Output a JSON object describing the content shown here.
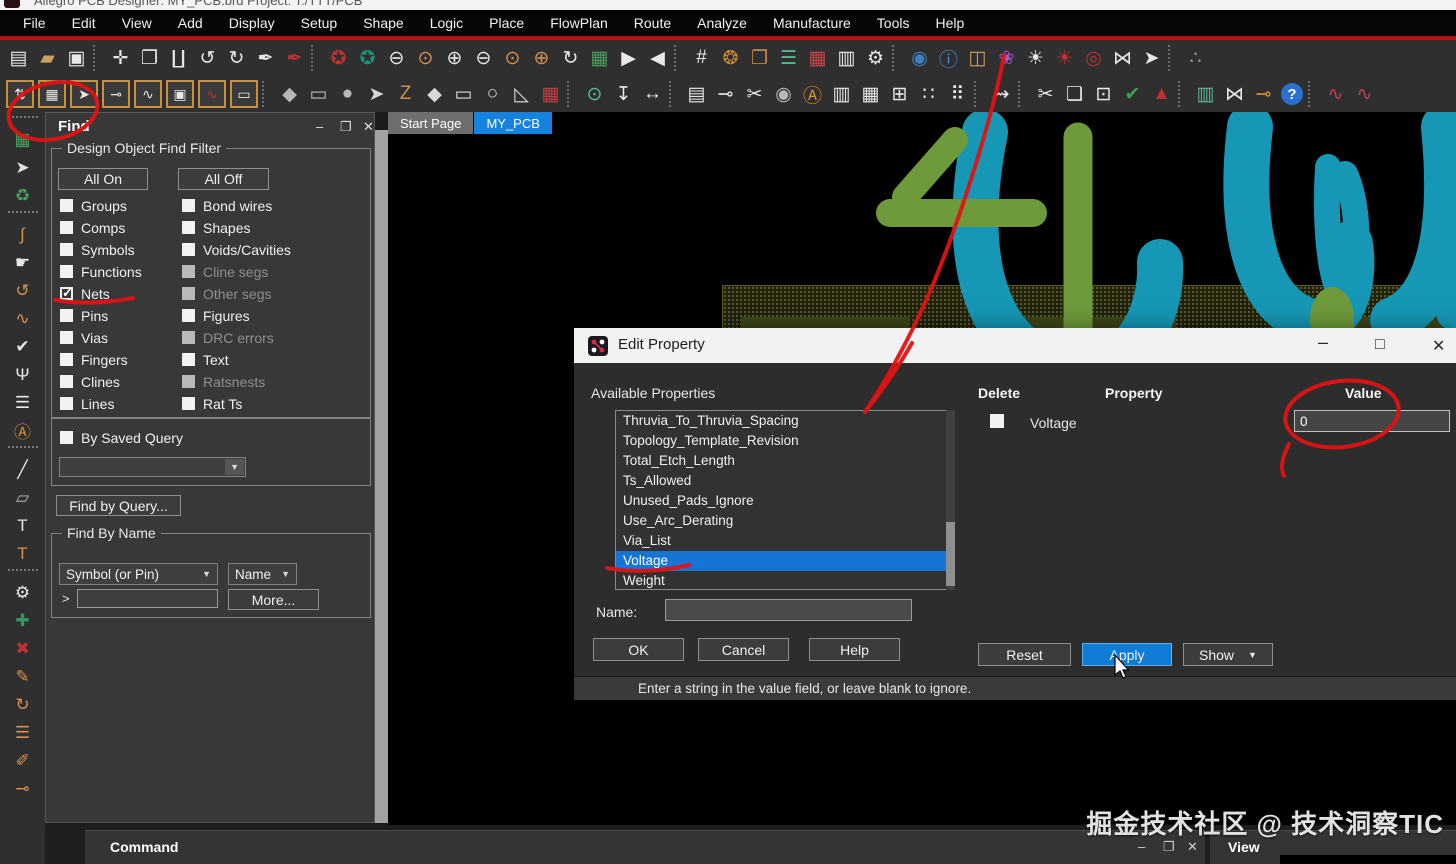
{
  "window": {
    "title": "Allegro PCB Designer: MY_PCB.brd Project: T:/TTT/PCB"
  },
  "menu": {
    "items": [
      "File",
      "Edit",
      "View",
      "Add",
      "Display",
      "Setup",
      "Shape",
      "Logic",
      "Place",
      "FlowPlan",
      "Route",
      "Analyze",
      "Manufacture",
      "Tools",
      "Help"
    ]
  },
  "toolbar1": {
    "icons": [
      {
        "name": "new-drawing",
        "glyph": "▤",
        "color": "#e8e8e8"
      },
      {
        "name": "open-drawing",
        "glyph": "▰",
        "color": "#c9a25e"
      },
      {
        "name": "save-drawing",
        "glyph": "▣",
        "color": "#e8e8e8"
      },
      {
        "name": "separator",
        "type": "sep"
      },
      {
        "name": "move",
        "glyph": "✛",
        "color": "#e8e8e8"
      },
      {
        "name": "copy",
        "glyph": "❐",
        "color": "#e8e8e8"
      },
      {
        "name": "delete",
        "glyph": "∐",
        "color": "#e8e8e8"
      },
      {
        "name": "undo",
        "glyph": "↺",
        "color": "#e8e8e8"
      },
      {
        "name": "redo",
        "glyph": "↻",
        "color": "#e8e8e8"
      },
      {
        "name": "pin",
        "glyph": "✒",
        "color": "#e8e8e8"
      },
      {
        "name": "unpin",
        "glyph": "✒",
        "color": "#c03030"
      },
      {
        "name": "separator",
        "type": "sep"
      },
      {
        "name": "highlight-red-circle",
        "glyph": "✪",
        "color": "#c03030"
      },
      {
        "name": "highlight-green-circle",
        "glyph": "✪",
        "color": "#1f8f7a"
      },
      {
        "name": "zoom-out-small",
        "glyph": "⊖",
        "color": "#e8e8e8"
      },
      {
        "name": "zoom-region",
        "glyph": "⊙",
        "color": "#d89050"
      },
      {
        "name": "zoom-in",
        "glyph": "⊕",
        "color": "#e8e8e8"
      },
      {
        "name": "zoom-out",
        "glyph": "⊖",
        "color": "#e8e8e8"
      },
      {
        "name": "zoom-previous",
        "glyph": "⊙",
        "color": "#d89050"
      },
      {
        "name": "zoom-center",
        "glyph": "⊕",
        "color": "#d89050"
      },
      {
        "name": "redraw",
        "glyph": "↻",
        "color": "#e8e8e8"
      },
      {
        "name": "board-view",
        "glyph": "▦",
        "color": "#49a35c"
      },
      {
        "name": "flip-forward",
        "glyph": "▶",
        "color": "#e8e8e8"
      },
      {
        "name": "flip-back",
        "glyph": "◀",
        "color": "#e8e8e8"
      },
      {
        "name": "separator",
        "type": "sep"
      },
      {
        "name": "grid-toggle",
        "glyph": "#",
        "color": "#e8e8e8"
      },
      {
        "name": "color-wheel",
        "glyph": "❂",
        "color": "#d08a2e"
      },
      {
        "name": "color-copy",
        "glyph": "❐",
        "color": "#c98f4a"
      },
      {
        "name": "layer-stack",
        "glyph": "☰",
        "color": "#58b890"
      },
      {
        "name": "color-dialog-doc",
        "glyph": "▦",
        "color": "#cc4444"
      },
      {
        "name": "report-doc",
        "glyph": "▥",
        "color": "#e8e8e8"
      },
      {
        "name": "parameter-doc",
        "glyph": "⚙",
        "color": "#e8e8e8"
      },
      {
        "name": "separator",
        "type": "sep"
      },
      {
        "name": "visibility-eye",
        "glyph": "◉",
        "color": "#3d7fc4"
      },
      {
        "name": "element-info",
        "glyph": "ⓘ",
        "color": "#4a8fd4"
      },
      {
        "name": "measure-3d",
        "glyph": "◫",
        "color": "#c9a25e"
      },
      {
        "name": "color-palette",
        "glyph": "❀",
        "color": "#9a5ac8"
      },
      {
        "name": "shine-on",
        "glyph": "☀",
        "color": "#e8e8e8"
      },
      {
        "name": "shine-off",
        "glyph": "☀",
        "color": "#c03030"
      },
      {
        "name": "filled-pads-off",
        "glyph": "◎",
        "color": "#c03030"
      },
      {
        "name": "waitstate-hourglass",
        "glyph": "⋈",
        "color": "#e8e8e8"
      },
      {
        "name": "pick-cursor",
        "glyph": "➤",
        "color": "#e8e8e8"
      },
      {
        "name": "separator",
        "type": "sep"
      },
      {
        "name": "share",
        "glyph": "∴",
        "color": "#9a9a9a"
      }
    ]
  },
  "toolbar2": {
    "icons": [
      {
        "name": "show-measure",
        "glyph": "⇅",
        "color": "#e8e8e8",
        "type": "framed"
      },
      {
        "name": "highlight-element",
        "glyph": "▦",
        "color": "#e8e8e8",
        "type": "framed"
      },
      {
        "name": "select-element",
        "glyph": "➤",
        "color": "#e8e8e8",
        "type": "framed"
      },
      {
        "name": "probe-pin",
        "glyph": "⊸",
        "color": "#e8e8e8",
        "type": "framed"
      },
      {
        "name": "waveform-probe",
        "glyph": "∿",
        "color": "#e8e8e8",
        "type": "framed"
      },
      {
        "name": "drc-browser",
        "glyph": "▣",
        "color": "#e8e8e8",
        "type": "framed"
      },
      {
        "name": "elongation-curve",
        "glyph": "∿",
        "color": "#c03030",
        "type": "framed"
      },
      {
        "name": "frame-select",
        "glyph": "▭",
        "color": "#e8e8e8",
        "type": "framed"
      },
      {
        "name": "separator",
        "type": "sep"
      },
      {
        "name": "add-polygon",
        "glyph": "◆",
        "color": "#b8b8b8"
      },
      {
        "name": "add-rectangle",
        "glyph": "▭",
        "color": "#b8b8b8"
      },
      {
        "name": "add-circle",
        "glyph": "●",
        "color": "#b8b8b8"
      },
      {
        "name": "select-shape",
        "glyph": "➤",
        "color": "#d8d8d8"
      },
      {
        "name": "edit-boundary",
        "glyph": "Z",
        "color": "#c98f4a"
      },
      {
        "name": "shape-polygon",
        "glyph": "◆",
        "color": "#d8d8d8"
      },
      {
        "name": "shape-rectangle",
        "glyph": "▭",
        "color": "#d8d8d8"
      },
      {
        "name": "shape-circle",
        "glyph": "○",
        "color": "#d8d8d8"
      },
      {
        "name": "shape-wedge",
        "glyph": "◺",
        "color": "#d8d8d8"
      },
      {
        "name": "shape-board",
        "glyph": "▦",
        "color": "#c04040"
      },
      {
        "name": "separator",
        "type": "sep"
      },
      {
        "name": "zoom-highlight",
        "glyph": "⊙",
        "color": "#52c09a"
      },
      {
        "name": "dimension-drop",
        "glyph": "↧",
        "color": "#e8e8e8"
      },
      {
        "name": "spacing-arrows",
        "glyph": "↔",
        "color": "#e8e8e8"
      },
      {
        "name": "separator",
        "type": "sep"
      },
      {
        "name": "export-doc",
        "glyph": "▤",
        "color": "#e8e8e8"
      },
      {
        "name": "pin-report",
        "glyph": "⊸",
        "color": "#e8e8e8"
      },
      {
        "name": "pin-tools",
        "glyph": "✂",
        "color": "#e8e8e8"
      },
      {
        "name": "camera-settings",
        "glyph": "◉",
        "color": "#b8b8b8"
      },
      {
        "name": "auto-rename-r2",
        "glyph": "Ⓐ",
        "color": "#d89030"
      },
      {
        "name": "pin-doc",
        "glyph": "▥",
        "color": "#e8e8e8"
      },
      {
        "name": "grid-window",
        "glyph": "▦",
        "color": "#e8e8e8"
      },
      {
        "name": "testpoint-grid",
        "glyph": "⊞",
        "color": "#e8e8e8"
      },
      {
        "name": "dots-pattern",
        "glyph": "∷",
        "color": "#e8e8e8"
      },
      {
        "name": "pads-pattern",
        "glyph": "⠿",
        "color": "#e8e8e8"
      },
      {
        "name": "separator",
        "type": "sep"
      },
      {
        "name": "route-segment",
        "glyph": "⇝",
        "color": "#e8e8e8"
      },
      {
        "name": "separator",
        "type": "sep"
      },
      {
        "name": "wave-cut",
        "glyph": "✂",
        "color": "#e8e8e8"
      },
      {
        "name": "wave-book",
        "glyph": "❏",
        "color": "#e8e8e8"
      },
      {
        "name": "wave-box",
        "glyph": "⊡",
        "color": "#e8e8e8"
      },
      {
        "name": "wave-check",
        "glyph": "✔",
        "color": "#3fa04f"
      },
      {
        "name": "wave-warning",
        "glyph": "▲",
        "color": "#c03030"
      },
      {
        "name": "separator",
        "type": "sep"
      },
      {
        "name": "chart-doc",
        "glyph": "▥",
        "color": "#58b890"
      },
      {
        "name": "swap-views",
        "glyph": "⋈",
        "color": "#e8e8e8"
      },
      {
        "name": "pin-badge",
        "glyph": "⊸",
        "color": "#d89030"
      },
      {
        "name": "help",
        "glyph": "?",
        "color": "#ffffff",
        "type": "round-blue"
      },
      {
        "name": "separator",
        "type": "sep"
      },
      {
        "name": "ripup-add",
        "glyph": "∿",
        "color": "#c04050"
      },
      {
        "name": "ripup-edit",
        "glyph": "∿",
        "color": "#c04050"
      }
    ]
  },
  "sidebar": {
    "icons": [
      {
        "name": "separator",
        "type": "sep"
      },
      {
        "name": "board-green",
        "glyph": "▦",
        "color": "#49a35c"
      },
      {
        "name": "chip-select",
        "glyph": "➤",
        "color": "#e0e0e0"
      },
      {
        "name": "pads-refresh",
        "glyph": "♻",
        "color": "#49a35c"
      },
      {
        "name": "separator",
        "type": "sep"
      },
      {
        "name": "route-trace",
        "glyph": "∫",
        "color": "#d89050"
      },
      {
        "name": "slide-hand",
        "glyph": "☛",
        "color": "#e8e8e8"
      },
      {
        "name": "delay-tune",
        "glyph": "↺",
        "color": "#d89050"
      },
      {
        "name": "phase-tune",
        "glyph": "∿",
        "color": "#d89050"
      },
      {
        "name": "vertex-check",
        "glyph": "✔",
        "color": "#e8e8e8"
      },
      {
        "name": "fanout",
        "glyph": "Ψ",
        "color": "#e8e8e8"
      },
      {
        "name": "layer-lines",
        "glyph": "☰",
        "color": "#e8e8e8"
      },
      {
        "name": "auto-route-a",
        "glyph": "Ⓐ",
        "color": "#d89030"
      },
      {
        "name": "separator",
        "type": "sep"
      },
      {
        "name": "add-line",
        "glyph": "╱",
        "color": "#e8e8e8"
      },
      {
        "name": "add-shape",
        "glyph": "▱",
        "color": "#b8b8b8"
      },
      {
        "name": "add-text",
        "glyph": "T",
        "color": "#e8e8e8"
      },
      {
        "name": "edit-text",
        "glyph": "T",
        "color": "#d89050"
      },
      {
        "name": "separator",
        "type": "sep"
      },
      {
        "name": "pin-settings",
        "glyph": "⚙",
        "color": "#e8e8e8"
      },
      {
        "name": "pin-add",
        "glyph": "✚",
        "color": "#2f9a5f"
      },
      {
        "name": "pin-delete",
        "glyph": "✖",
        "color": "#c03030"
      },
      {
        "name": "pin-edit",
        "glyph": "✎",
        "color": "#d89050"
      },
      {
        "name": "pin-swap",
        "glyph": "↻",
        "color": "#d89050"
      },
      {
        "name": "pin-align",
        "glyph": "☰",
        "color": "#d89050"
      },
      {
        "name": "ripup",
        "glyph": "✐",
        "color": "#d89050"
      },
      {
        "name": "pin-probe",
        "glyph": "⊸",
        "color": "#d89050"
      }
    ]
  },
  "find": {
    "title": "Find",
    "filter_title": "Design Object Find Filter",
    "all_on": "All On",
    "all_off": "All Off",
    "left_items": [
      {
        "label": "Groups",
        "state": ""
      },
      {
        "label": "Comps",
        "state": ""
      },
      {
        "label": "Symbols",
        "state": ""
      },
      {
        "label": "Functions",
        "state": ""
      },
      {
        "label": "Nets",
        "state": "checked"
      },
      {
        "label": "Pins",
        "state": ""
      },
      {
        "label": "Vias",
        "state": ""
      },
      {
        "label": "Fingers",
        "state": ""
      },
      {
        "label": "Clines",
        "state": ""
      },
      {
        "label": "Lines",
        "state": ""
      }
    ],
    "right_items": [
      {
        "label": "Bond wires",
        "state": ""
      },
      {
        "label": "Shapes",
        "state": ""
      },
      {
        "label": "Voids/Cavities",
        "state": ""
      },
      {
        "label": "Cline segs",
        "state": "disabled"
      },
      {
        "label": "Other segs",
        "state": "disabled"
      },
      {
        "label": "Figures",
        "state": ""
      },
      {
        "label": "DRC errors",
        "state": "disabled"
      },
      {
        "label": "Text",
        "state": ""
      },
      {
        "label": "Ratsnests",
        "state": "disabled"
      },
      {
        "label": "Rat Ts",
        "state": ""
      }
    ],
    "by_saved_query": "By Saved Query",
    "find_by_query": "Find by Query...",
    "find_by_name": "Find By Name",
    "symbol_dropdown": "Symbol (or Pin)",
    "name_dropdown": "Name",
    "gt": ">",
    "more": "More..."
  },
  "tabs": {
    "items": [
      {
        "label": "Start Page",
        "state": ""
      },
      {
        "label": "MY_PCB",
        "state": "active"
      }
    ]
  },
  "dialog": {
    "title": "Edit Property",
    "available_properties": "Available Properties",
    "list": [
      {
        "label": "Thruvia_To_Thruvia_Spacing",
        "state": ""
      },
      {
        "label": "Topology_Template_Revision",
        "state": ""
      },
      {
        "label": "Total_Etch_Length",
        "state": ""
      },
      {
        "label": "Ts_Allowed",
        "state": ""
      },
      {
        "label": "Unused_Pads_Ignore",
        "state": ""
      },
      {
        "label": "Use_Arc_Derating",
        "state": ""
      },
      {
        "label": "Via_List",
        "state": ""
      },
      {
        "label": "Voltage",
        "state": "selected"
      },
      {
        "label": "Weight",
        "state": ""
      }
    ],
    "delete_header": "Delete",
    "property_header": "Property",
    "value_header": "Value",
    "property_row": {
      "name": "Voltage",
      "value": "0"
    },
    "name_label": "Name:",
    "ok": "OK",
    "cancel": "Cancel",
    "help": "Help",
    "reset": "Reset",
    "apply": "Apply",
    "show": "Show",
    "status": "Enter a string in the value field, or leave blank to ignore."
  },
  "bottom": {
    "command_title": "Command",
    "view_title": "View"
  },
  "watermark": "掘金技术社区 @ 技术洞察TIC",
  "colors": {
    "accent_blue": "#1583dd",
    "apply_blue": "#0f7cd6",
    "annotation_red": "#e01313",
    "pcb_teal": "#1697b5",
    "pcb_green": "#6f9a3c"
  }
}
